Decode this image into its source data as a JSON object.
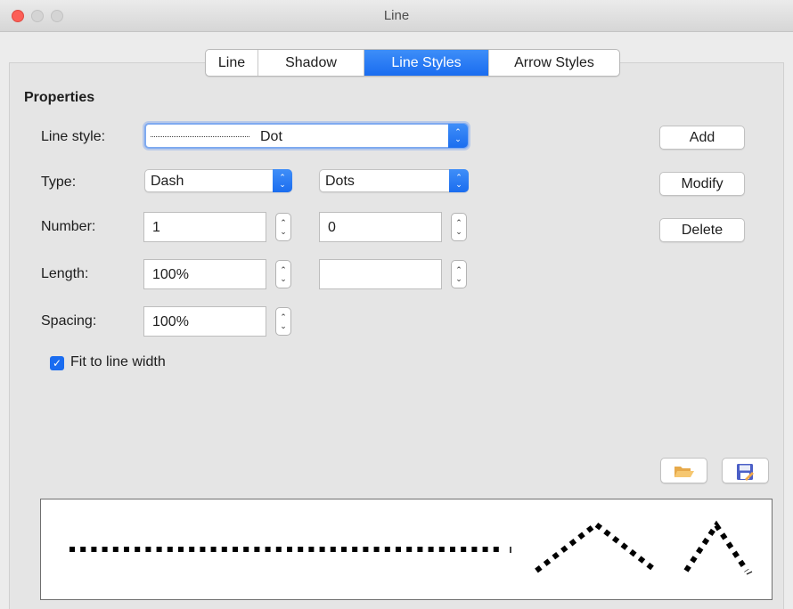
{
  "window": {
    "title": "Line"
  },
  "tabs": [
    {
      "label": "Line",
      "active": false
    },
    {
      "label": "Shadow",
      "active": false
    },
    {
      "label": "Line Styles",
      "active": true
    },
    {
      "label": "Arrow Styles",
      "active": false
    }
  ],
  "properties": {
    "heading": "Properties",
    "line_style": {
      "label": "Line style:",
      "value": "Dot"
    },
    "type": {
      "label": "Type:",
      "value_1": "Dash",
      "value_2": "Dots"
    },
    "number": {
      "label": "Number:",
      "value_1": "1",
      "value_2": "0"
    },
    "length": {
      "label": "Length:",
      "value_1": "100%",
      "value_2": ""
    },
    "spacing": {
      "label": "Spacing:",
      "value": "100%"
    },
    "fit_to_line_width": {
      "label": "Fit to line width",
      "checked": true
    }
  },
  "buttons": {
    "add": "Add",
    "modify": "Modify",
    "delete": "Delete"
  },
  "icons": {
    "load": "folder-open-icon",
    "save": "save-icon"
  },
  "colors": {
    "accent": "#1a6cf0",
    "close": "#fc5f57"
  }
}
